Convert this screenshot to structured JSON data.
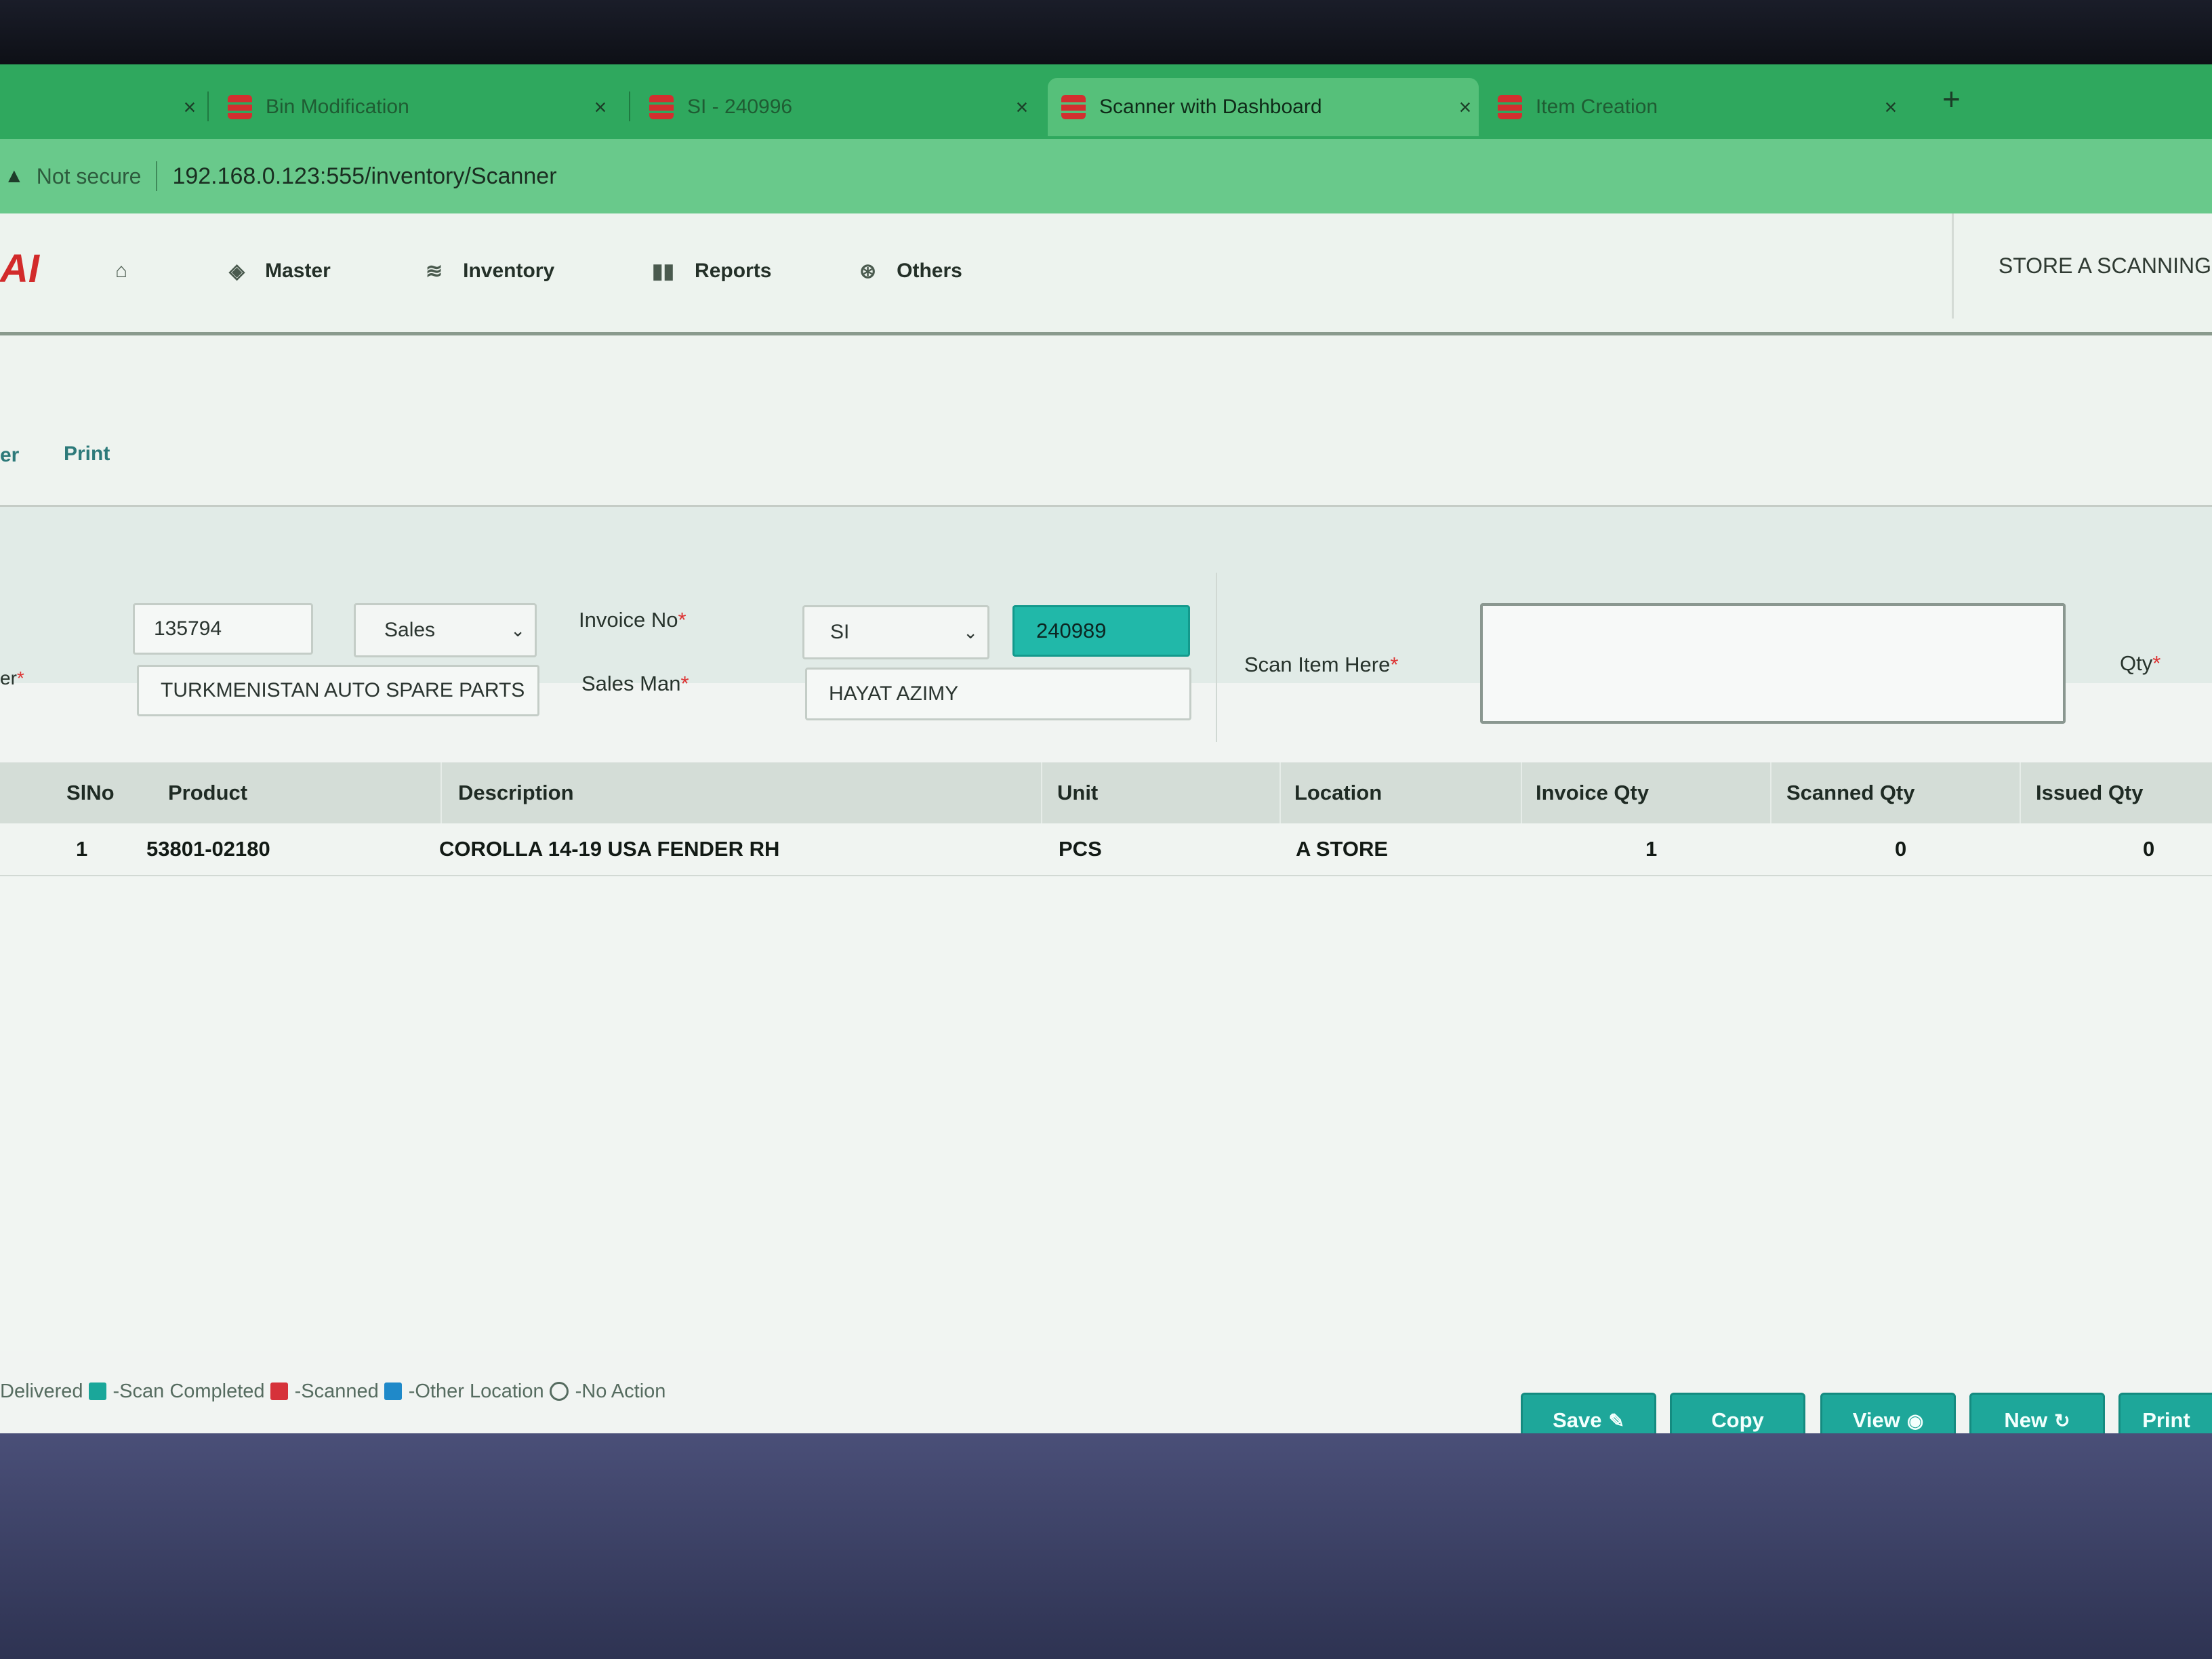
{
  "browser": {
    "tabs": [
      {
        "title": "Bin Modification"
      },
      {
        "title": "SI - 240996"
      },
      {
        "title": "Scanner with Dashboard",
        "active": true
      },
      {
        "title": "Item Creation"
      }
    ],
    "close_glyph": "×",
    "new_tab_glyph": "+",
    "security": "Not secure",
    "url": "192.168.0.123:555/inventory/Scanner"
  },
  "nav": {
    "logo": "AI",
    "items": [
      {
        "label": "Master",
        "icon": "cube-icon"
      },
      {
        "label": "Inventory",
        "icon": "database-icon"
      },
      {
        "label": "Reports",
        "icon": "bar-chart-icon"
      },
      {
        "label": "Others",
        "icon": "globe-icon"
      }
    ],
    "store_label": "STORE A SCANNING"
  },
  "subnav": {
    "partial": "er",
    "print": "Print"
  },
  "form": {
    "code_value": "135794",
    "type_value": "Sales",
    "customer_partial_label": "er",
    "customer_value": "TURKMENISTAN AUTO SPARE PARTS",
    "invoice_label": "Invoice No",
    "invoice_prefix": "SI",
    "invoice_number": "240989",
    "salesman_label": "Sales Man",
    "salesman_value": "HAYAT AZIMY",
    "scan_label": "Scan Item Here",
    "scan_value": "",
    "qty_label": "Qty",
    "required_mark": "*"
  },
  "table": {
    "headers": [
      "SlNo",
      "Product",
      "Description",
      "Unit",
      "Location",
      "Invoice Qty",
      "Scanned Qty",
      "Issued Qty"
    ],
    "rows": [
      [
        "1",
        "53801-02180",
        "COROLLA 14-19 USA FENDER RH",
        "PCS",
        "A STORE",
        "1",
        "0",
        "0"
      ]
    ]
  },
  "legend": {
    "delivered": "Delivered",
    "scan_completed": "-Scan Completed",
    "scanned": "-Scanned",
    "other_location": "-Other Location",
    "no_action": "-No Action",
    "colors": {
      "scan_completed": "#1aa79a",
      "scanned": "#d6323a",
      "other_location": "#1f89c9"
    }
  },
  "actions": {
    "save": "Save",
    "copy": "Copy",
    "view": "View",
    "new": "New",
    "print": "Print"
  },
  "colors": {
    "accent": "#1ea79a",
    "tab_bar": "#2fa85e",
    "required": "#dd3333"
  }
}
